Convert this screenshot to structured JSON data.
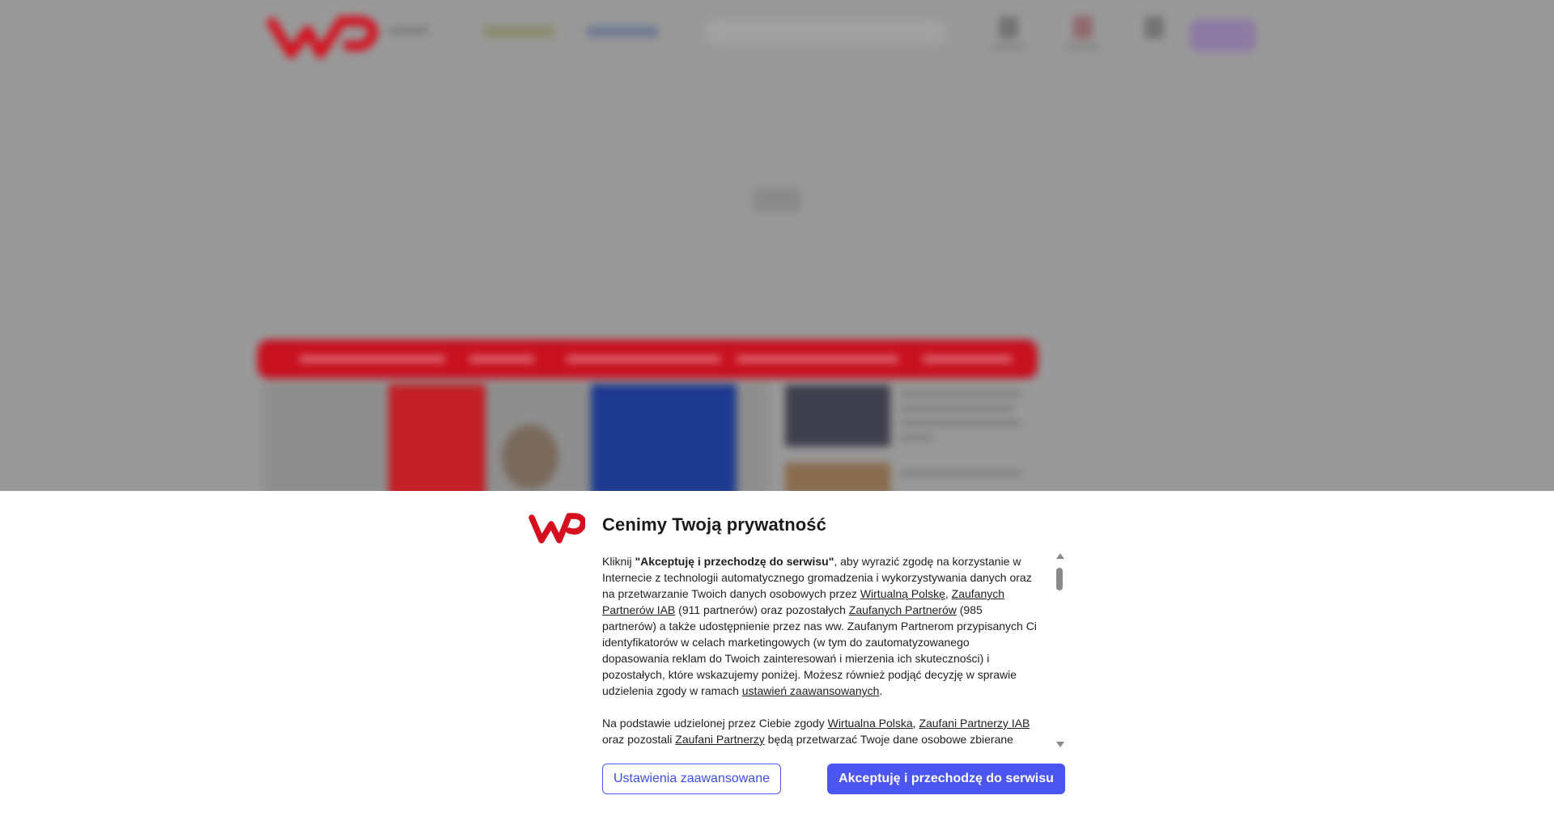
{
  "consent": {
    "title": "Cenimy Twoją prywatność",
    "p1_part1": "Kliknij ",
    "p1_bold": "\"Akceptuję i przechodzę do serwisu\"",
    "p1_part2": ", aby wyrazić zgodę na korzystanie w Internecie z technologii automatycznego gromadzenia i wykorzystywania danych oraz na przetwarzanie Twoich danych osobowych przez ",
    "p1_link1": "Wirtualną Polskę",
    "p1_sep1": ", ",
    "p1_link2": "Zaufanych Partnerów IAB",
    "p1_part3": " (911 partnerów) oraz pozostałych ",
    "p1_link3": "Zaufanych Partnerów",
    "p1_part4": " (985 partnerów) a także udostępnienie przez nas ww. Zaufanym Partnerom przypisanych Ci identyfikatorów w celach marketingowych (w tym do zautomatyzowanego dopasowania reklam do Twoich zainteresowań i mierzenia ich skuteczności) i pozostałych, które wskazujemy poniżej. Możesz również podjąć decyzję w sprawie udzielenia zgody w ramach ",
    "p1_link4": "ustawień zaawansowanych",
    "p1_end": ".",
    "p2_part1": "Na podstawie udzielonej przez Ciebie zgody ",
    "p2_link1": "Wirtualna Polska",
    "p2_sep1": ", ",
    "p2_link2": "Zaufani Partnerzy IAB",
    "p2_part2": " oraz pozostali ",
    "p2_link3": "Zaufani Partnerzy",
    "p2_part3": " będą przetwarzać Twoje dane osobowe zbierane",
    "btn_settings": "Ustawienia zaawansowane",
    "btn_accept": "Akceptuję i przechodzę do serwisu"
  },
  "icons": {
    "logo": "wp-logo-icon",
    "scroll_up": "scroll-up-arrow-icon",
    "scroll_down": "scroll-down-arrow-icon"
  },
  "colors": {
    "brand_red": "#d5101e",
    "accent_blue": "#4b55f2",
    "overlay_gray": "#999999"
  }
}
